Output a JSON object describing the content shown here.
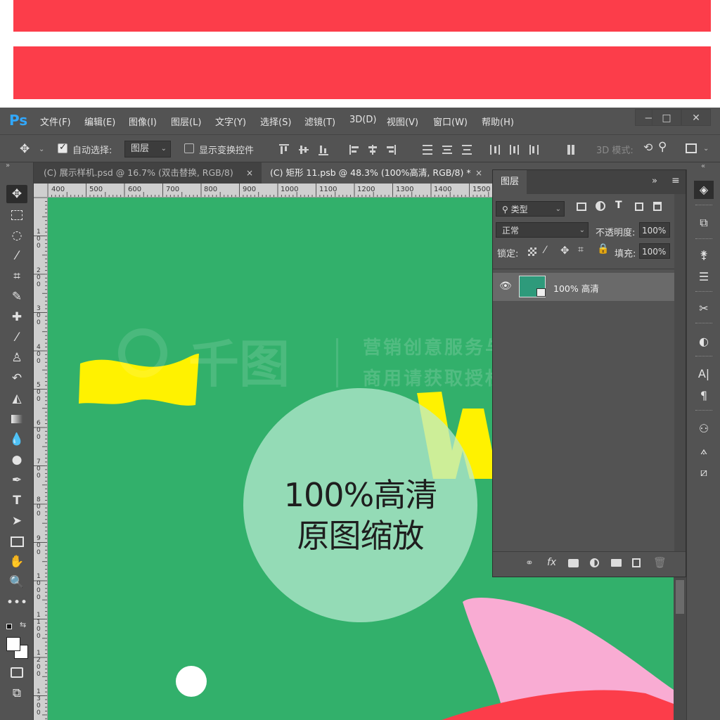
{
  "menubar": {
    "logo": "Ps",
    "items": [
      "文件(F)",
      "编辑(E)",
      "图像(I)",
      "图层(L)",
      "文字(Y)",
      "选择(S)",
      "滤镜(T)",
      "3D(D)",
      "视图(V)",
      "窗口(W)",
      "帮助(H)"
    ],
    "window_controls": [
      "—",
      "□",
      "✕"
    ]
  },
  "options": {
    "auto_select_label": "自动选择:",
    "auto_select_value": "图层",
    "show_transform_label": "显示变换控件",
    "mode_3d_label": "3D 模式:"
  },
  "tabs": [
    {
      "label": "(C) 展示样机.psd @ 16.7% (双击替换, RGB/8)",
      "close": "×"
    },
    {
      "label": "(C) 矩形 11.psb @ 48.3% (100%高清, RGB/8) *",
      "close": "×"
    }
  ],
  "ruler": {
    "top_ticks": [
      "400",
      "500",
      "600",
      "700",
      "800",
      "900",
      "1000",
      "1100",
      "1200",
      "1300",
      "1400",
      "1500"
    ],
    "left_ticks": [
      "1\n0\n0",
      "2\n0\n0",
      "3\n0\n0",
      "4\n0\n0",
      "5\n0\n0",
      "6\n0\n0",
      "7\n0\n0",
      "8\n0\n0",
      "9\n0\n0",
      "1\n0\n0\n0",
      "1\n1\n0\n0",
      "1\n2\n0\n0",
      "1\n3\n0\n0"
    ]
  },
  "layers_panel": {
    "title": "图层",
    "filter_label": "类型",
    "blend_mode": "正常",
    "opacity_label": "不透明度:",
    "opacity_value": "100%",
    "lock_label": "锁定:",
    "fill_label": "填充:",
    "fill_value": "100%",
    "layer_name": "100% 高清"
  },
  "overlay": {
    "line1": "100%高清",
    "line2": "原图缩放"
  },
  "watermark": {
    "brand": "千图",
    "line1": "营销创意服务与协作平台",
    "line2": "商用请获取授权"
  },
  "colors": {
    "banner_red": "#fc3d4a",
    "canvas_green": "#32b06b",
    "ps_panel": "#535353",
    "ps_blue": "#31a8ff"
  }
}
